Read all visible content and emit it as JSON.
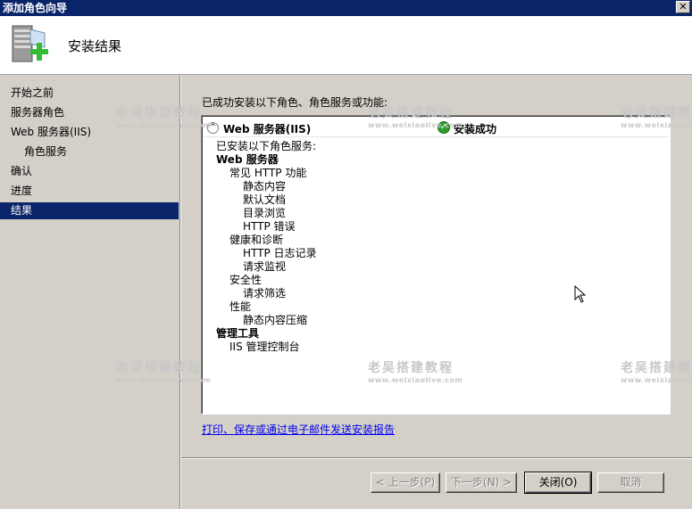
{
  "window": {
    "title": "添加角色向导",
    "close_glyph": "✕"
  },
  "header": {
    "title": "安装结果",
    "icon": "server-add-icon"
  },
  "sidebar": {
    "items": [
      {
        "label": "开始之前",
        "active": false
      },
      {
        "label": "服务器角色",
        "active": false
      },
      {
        "label": "Web 服务器(IIS)",
        "active": false
      },
      {
        "label": "角色服务",
        "active": false
      },
      {
        "label": "确认",
        "active": false
      },
      {
        "label": "进度",
        "active": false
      },
      {
        "label": "结果",
        "active": true
      }
    ]
  },
  "main": {
    "intro": "已成功安装以下角色、角色服务或功能:",
    "result": {
      "collapse_glyph": "^",
      "role": "Web 服务器(IIS)",
      "status_icon": "check-circle-icon",
      "status": "安装成功"
    },
    "details": [
      "已安装以下角色服务:",
      "Web 服务器",
      "常见 HTTP 功能",
      "静态内容",
      "默认文档",
      "目录浏览",
      "HTTP 错误",
      "健康和诊断",
      "HTTP 日志记录",
      "请求监视",
      "安全性",
      "请求筛选",
      "性能",
      "静态内容压缩",
      "管理工具",
      "IIS 管理控制台"
    ],
    "report_link": "打印、保存或通过电子邮件发送安装报告"
  },
  "buttons": {
    "prev": "< 上一步(P)",
    "next": "下一步(N) >",
    "close": "关闭(O)",
    "cancel": "取消"
  },
  "watermark": {
    "text": "老吴搭建教程",
    "url": "www.weixiaolive.com"
  },
  "colors": {
    "titlebar": "#0a246a",
    "selection": "#0a246a",
    "face": "#d4d0c8",
    "link": "#0000ee",
    "success": "#2f9e2f"
  }
}
